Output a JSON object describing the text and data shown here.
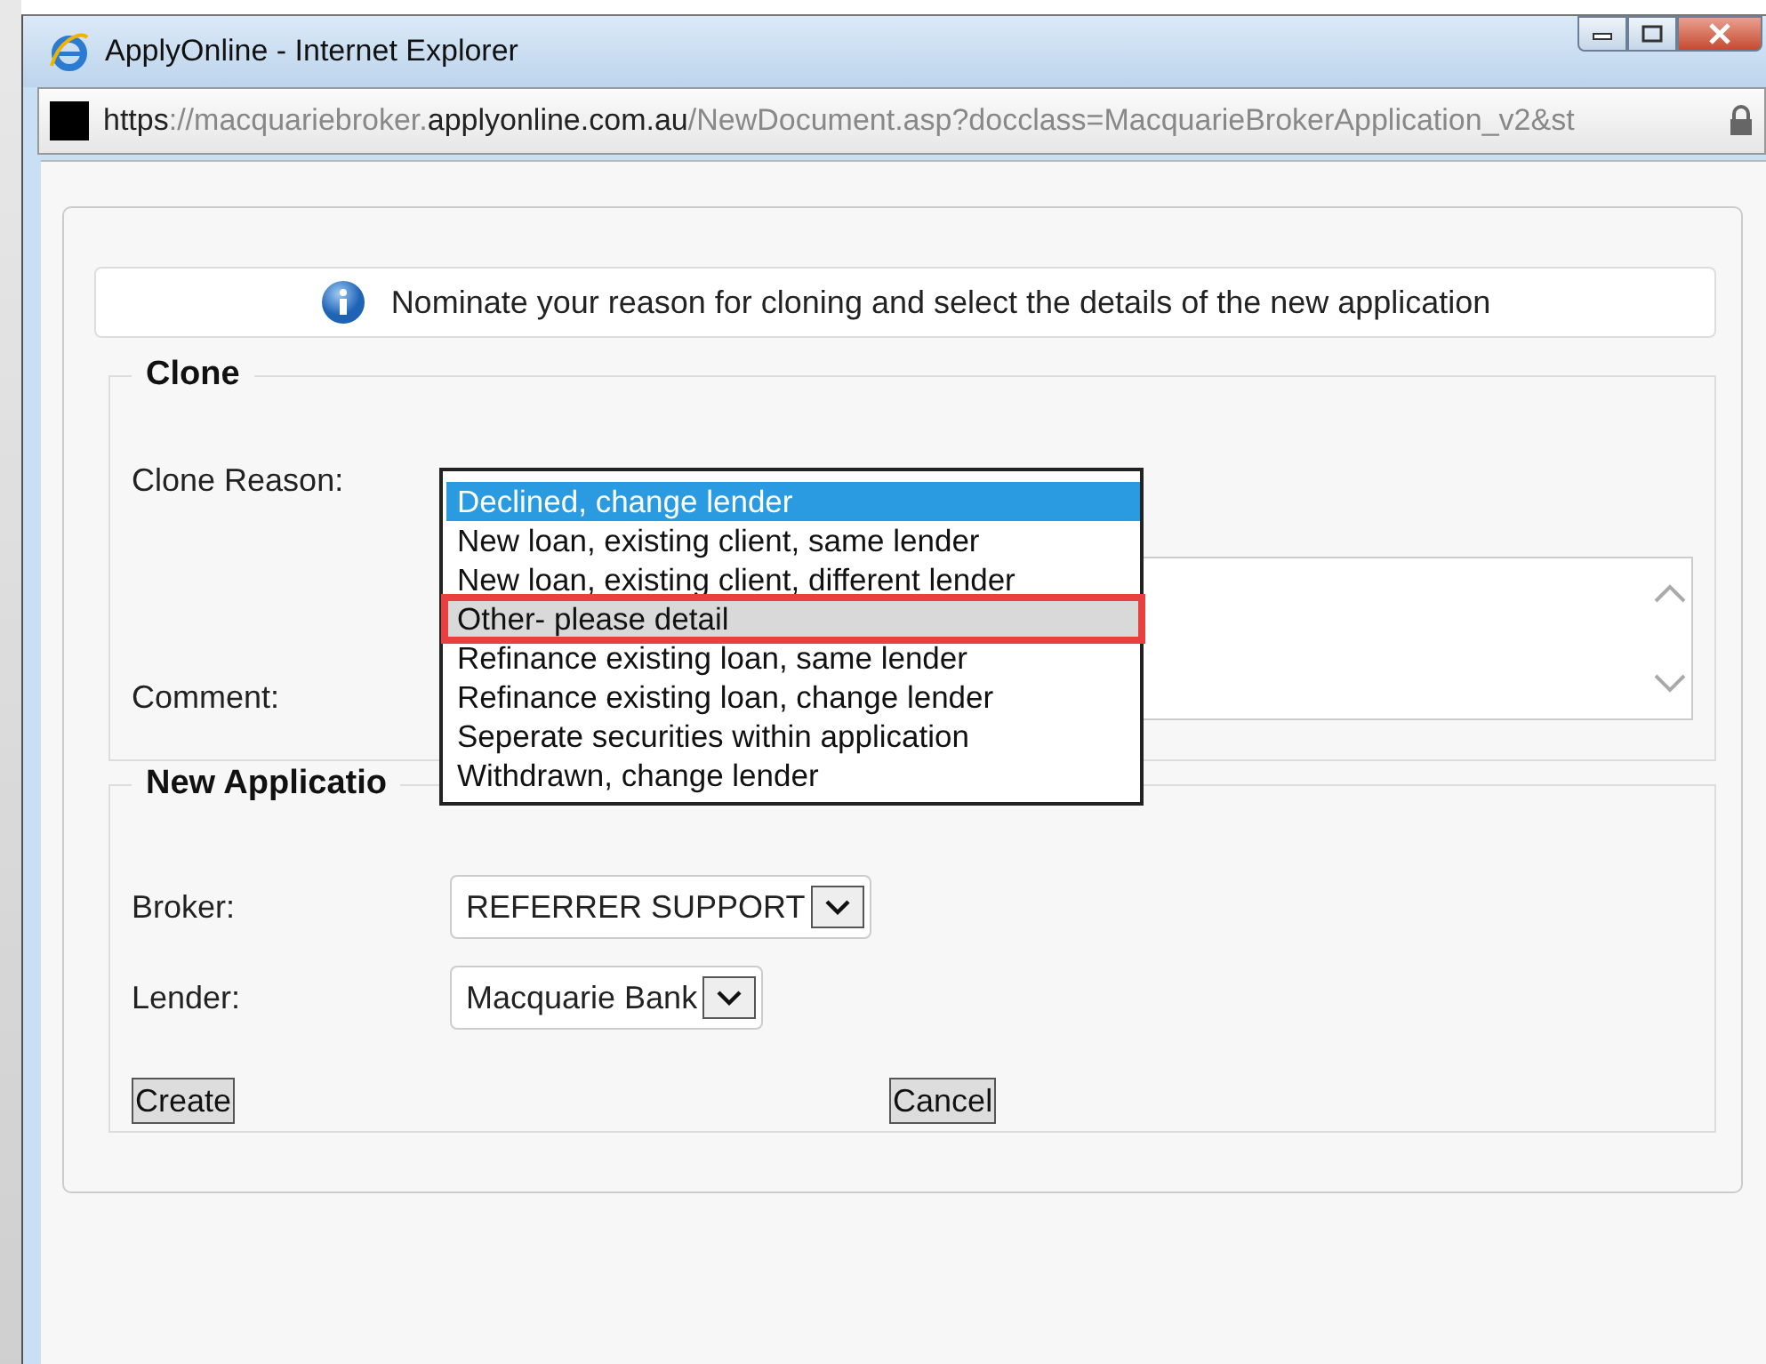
{
  "window": {
    "title": "ApplyOnline - Internet Explorer"
  },
  "address_bar": {
    "parts": [
      {
        "text": "https",
        "dim": false
      },
      {
        "text": "://macquariebroker.",
        "dim": true
      },
      {
        "text": "applyonline.com.au",
        "dim": false
      },
      {
        "text": "/NewDocument.asp?docclass=MacquarieBrokerApplication_v2&st",
        "dim": true
      }
    ]
  },
  "info_message": "Nominate your reason for cloning and select the details of the new application",
  "clone": {
    "legend": "Clone",
    "reason_label": "Clone Reason:",
    "comment_label": "Comment:",
    "reason_options": [
      {
        "label": "Declined, change lender",
        "selected": true,
        "hovered": false,
        "marked": false
      },
      {
        "label": "New loan, existing client, same lender",
        "selected": false,
        "hovered": false,
        "marked": false
      },
      {
        "label": "New loan, existing client, different lender",
        "selected": false,
        "hovered": false,
        "marked": false
      },
      {
        "label": "Other- please detail",
        "selected": false,
        "hovered": true,
        "marked": true
      },
      {
        "label": "Refinance existing loan, same lender",
        "selected": false,
        "hovered": false,
        "marked": false
      },
      {
        "label": "Refinance existing loan, change lender",
        "selected": false,
        "hovered": false,
        "marked": false
      },
      {
        "label": "Seperate securities within application",
        "selected": false,
        "hovered": false,
        "marked": false
      },
      {
        "label": "Withdrawn, change lender",
        "selected": false,
        "hovered": false,
        "marked": false
      }
    ]
  },
  "new_application": {
    "legend": "New Applicatio",
    "fields": [
      {
        "label": "Broker:",
        "value": "REFERRER SUPPORT"
      },
      {
        "label": "Lender:",
        "value": "Macquarie Bank"
      }
    ]
  },
  "buttons": [
    "Create",
    "Cancel"
  ]
}
